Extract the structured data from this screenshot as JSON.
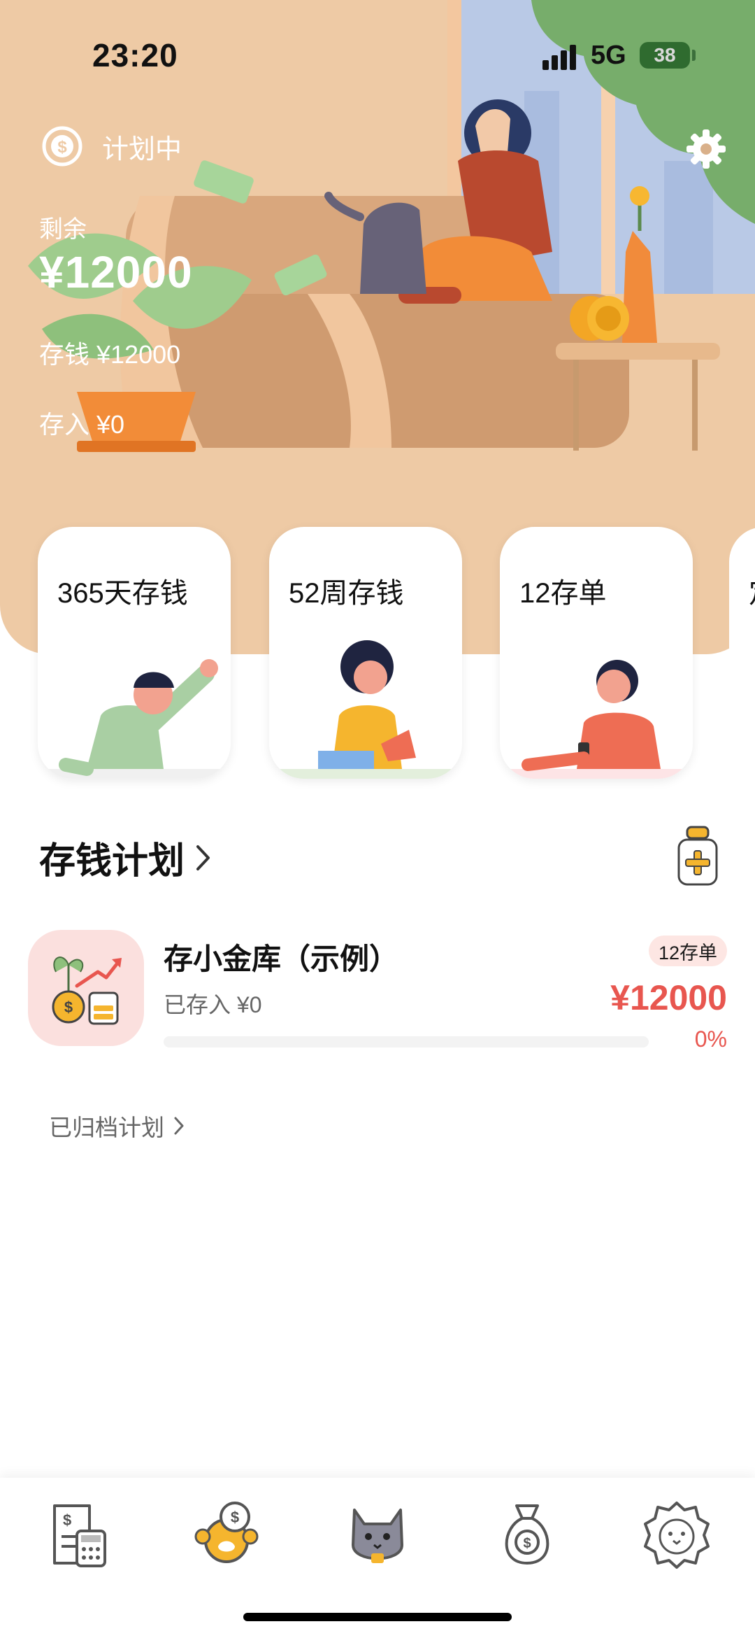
{
  "status_bar": {
    "time": "23:20",
    "network": "5G",
    "battery": "38"
  },
  "header": {
    "plan_status": "计划中",
    "remaining_label": "剩余",
    "remaining_amount": "¥12000",
    "save_line": "存钱 ¥12000",
    "deposit_line": "存入 ¥0"
  },
  "methods": [
    {
      "label": "365天存钱"
    },
    {
      "label": "52周存钱"
    },
    {
      "label": "12存单"
    },
    {
      "label": "定"
    }
  ],
  "plans_section": {
    "title": "存钱计划"
  },
  "plans": [
    {
      "name": "存小金库（示例）",
      "deposited": "已存入 ¥0",
      "tag": "12存单",
      "amount": "¥12000",
      "percent": "0%",
      "progress": 0
    }
  ],
  "archived_label": "已归档计划",
  "nav": [
    {
      "icon": "bill-calculator-icon"
    },
    {
      "icon": "coin-paw-icon"
    },
    {
      "icon": "cat-icon"
    },
    {
      "icon": "money-bag-icon"
    },
    {
      "icon": "lion-face-icon"
    }
  ],
  "colors": {
    "hero_bg": "#eecaa5",
    "accent": "#e8564f",
    "card_bg": "#ffffff",
    "tag_bg": "#fde6e3"
  }
}
